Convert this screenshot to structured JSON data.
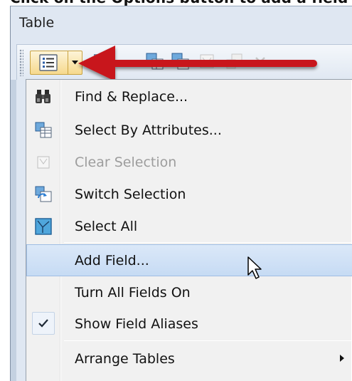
{
  "top_caption": "Click on the Options button to add a field",
  "window": {
    "title": "Table"
  },
  "toolbar": {
    "options_button": {
      "icon": "table-options-icon"
    },
    "buttons": [
      {
        "icon": "related-tables-icon",
        "enabled": true
      },
      {
        "icon": "select-by-attributes-icon",
        "enabled": true
      },
      {
        "icon": "switch-selection-icon",
        "enabled": true
      },
      {
        "icon": "clear-selection-icon",
        "enabled": false
      },
      {
        "icon": "zoom-to-selected-icon",
        "enabled": false
      },
      {
        "icon": "delete-selected-icon",
        "enabled": false
      }
    ]
  },
  "menu": {
    "items": [
      {
        "label": "Find & Replace...",
        "icon": "binoculars-icon",
        "enabled": true
      },
      {
        "label": "Select By Attributes...",
        "icon": "select-by-attributes-icon",
        "enabled": true
      },
      {
        "label": "Clear Selection",
        "icon": "clear-selection-icon",
        "enabled": false
      },
      {
        "label": "Switch Selection",
        "icon": "switch-selection-icon",
        "enabled": true
      },
      {
        "label": "Select All",
        "icon": "select-all-icon",
        "enabled": true
      },
      {
        "label": "Add Field...",
        "enabled": true,
        "highlighted": true
      },
      {
        "label": "Turn All Fields On",
        "enabled": true
      },
      {
        "label": "Show Field Aliases",
        "enabled": true,
        "checked": true
      },
      {
        "label": "Arrange Tables",
        "enabled": true,
        "has_submenu": true
      }
    ]
  },
  "colors": {
    "annotation_arrow": "#c8151b",
    "menu_highlight": "#c6dbf4",
    "options_button": "#f6d98d"
  }
}
